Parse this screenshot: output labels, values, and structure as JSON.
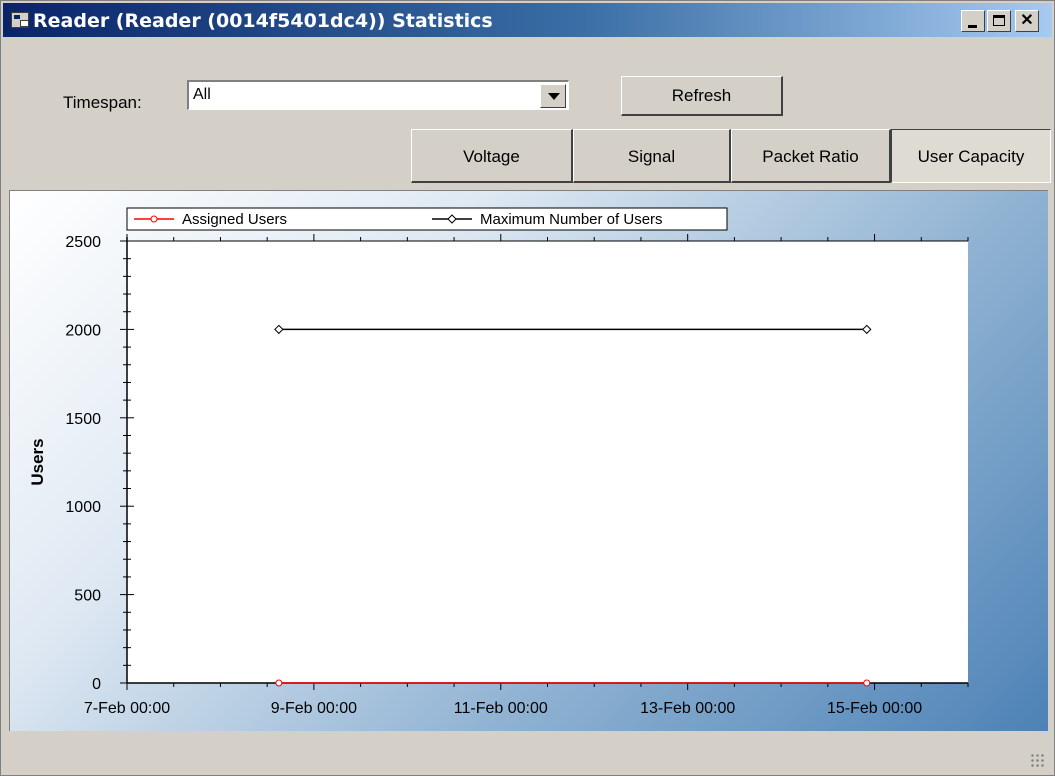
{
  "window": {
    "title": "Reader (Reader (0014f5401dc4)) Statistics",
    "title_gradient": [
      "#0a246a",
      "#a6caf0"
    ]
  },
  "controls": {
    "timespan_label": "Timespan:",
    "timespan_value": "All",
    "refresh_label": "Refresh"
  },
  "tabs": [
    {
      "label": "Voltage",
      "selected": false
    },
    {
      "label": "Signal",
      "selected": false
    },
    {
      "label": "Packet Ratio",
      "selected": false
    },
    {
      "label": "User Capacity",
      "selected": true
    }
  ],
  "icons": {
    "app": "app-window-icon",
    "minimize": "minimize-icon",
    "maximize": "maximize-icon",
    "close": "close-icon",
    "dropdown": "chevron-down-icon",
    "resize": "resize-grip-icon"
  },
  "chart_data": {
    "type": "line",
    "ylabel": "Users",
    "xlabel": "",
    "ylim": [
      0,
      2500
    ],
    "yticks": [
      0,
      500,
      1000,
      1500,
      2000,
      2500
    ],
    "xlim": [
      "7-Feb 00:00",
      "16-Feb 00:00"
    ],
    "xticks": [
      "7-Feb 00:00",
      "9-Feb 00:00",
      "11-Feb 00:00",
      "13-Feb 00:00",
      "15-Feb 00:00"
    ],
    "legend_position": "top",
    "grid": false,
    "series": [
      {
        "name": "Assigned Users",
        "color": "#ff0000",
        "marker": "circle",
        "x": [
          "8-Feb 15:00",
          "14-Feb 22:00"
        ],
        "values": [
          0,
          0
        ]
      },
      {
        "name": "Maximum Number of Users",
        "color": "#000000",
        "marker": "diamond",
        "x": [
          "8-Feb 15:00",
          "14-Feb 22:00"
        ],
        "values": [
          2000,
          2000
        ]
      }
    ]
  }
}
